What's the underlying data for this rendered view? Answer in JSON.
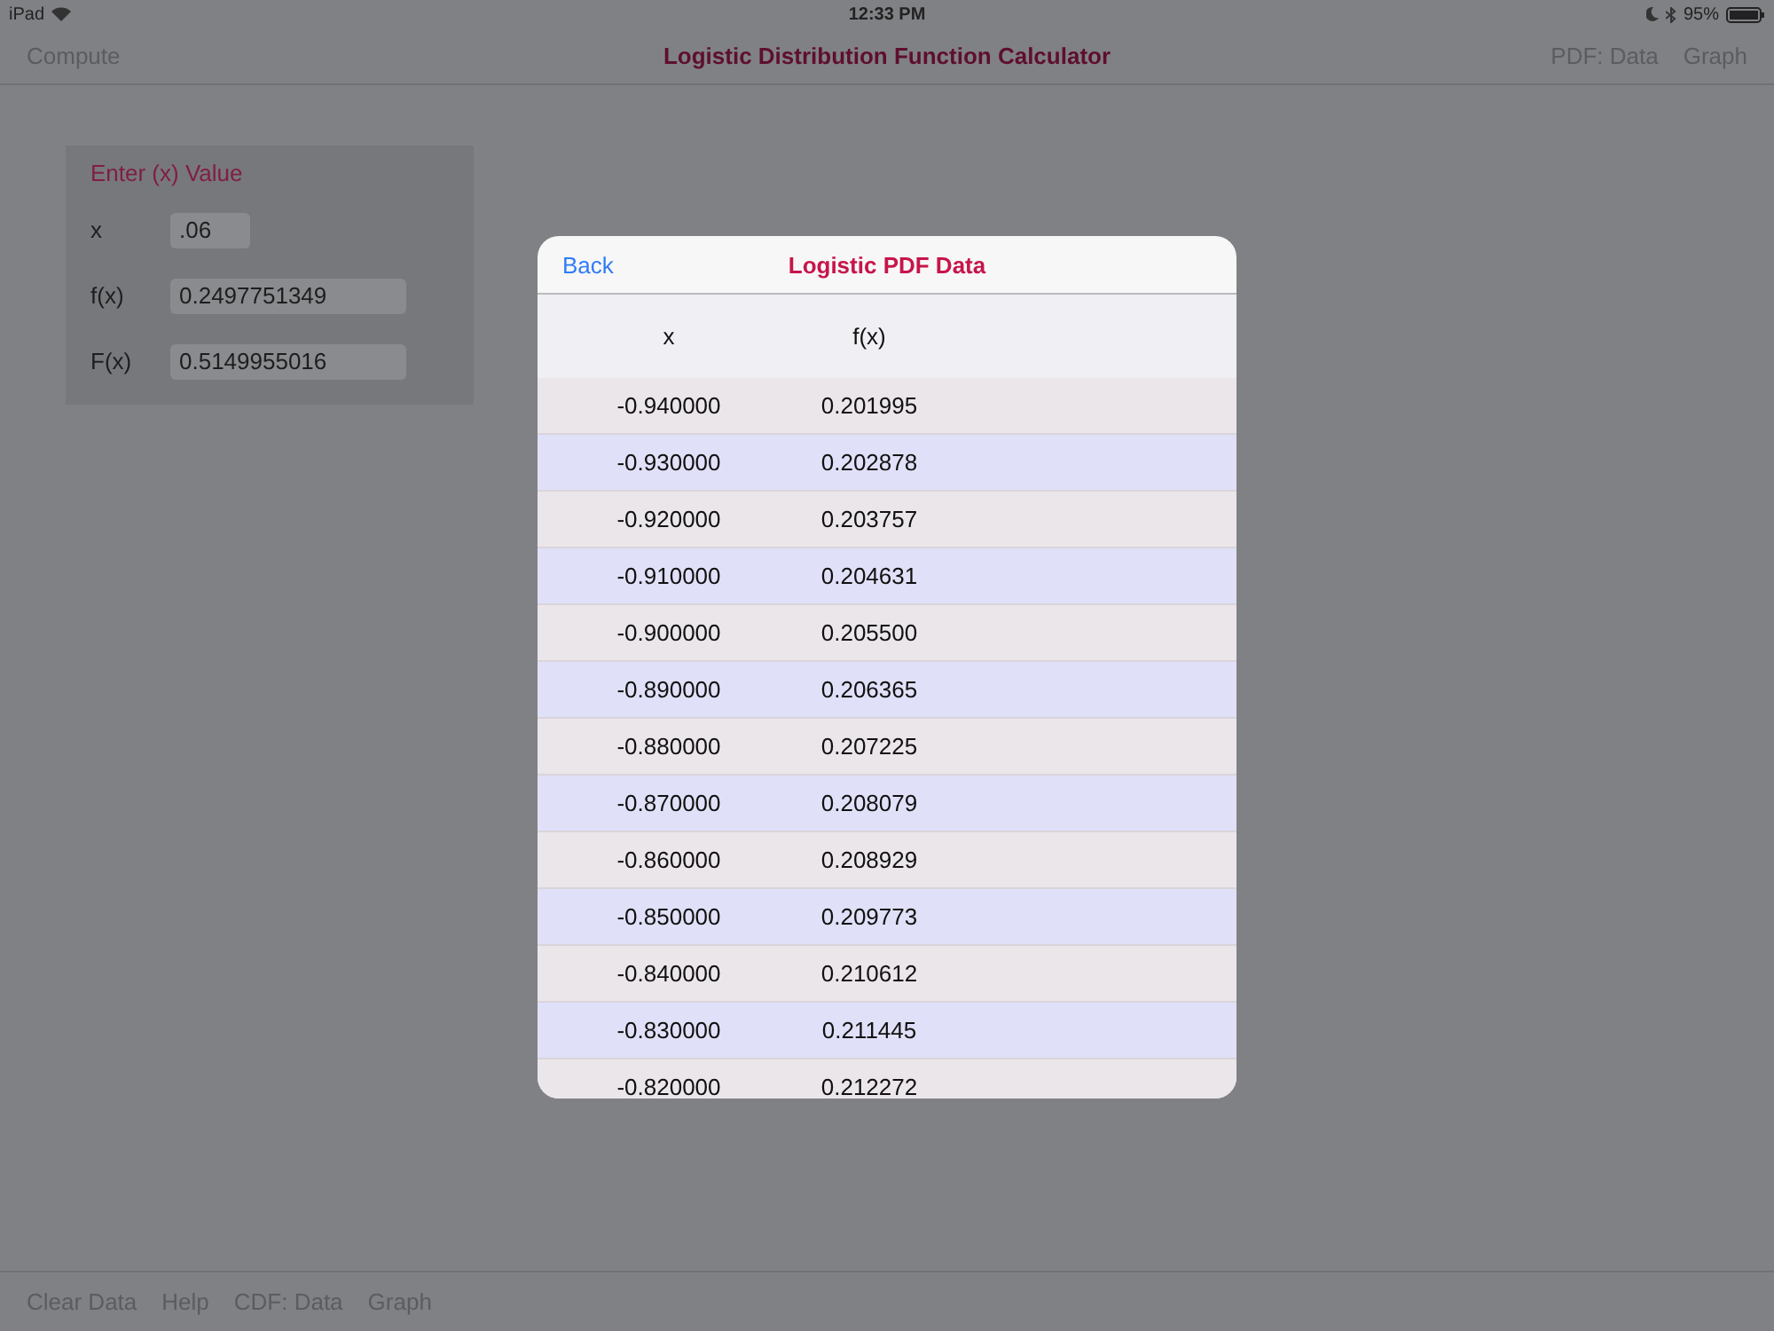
{
  "status_bar": {
    "device": "iPad",
    "time": "12:33 PM",
    "battery": "95%"
  },
  "nav_bar": {
    "left": "Compute",
    "title": "Logistic Distribution Function Calculator",
    "right": [
      "PDF: Data",
      "Graph"
    ]
  },
  "input_panel": {
    "title": "Enter (x) Value",
    "fields": [
      {
        "label": "x",
        "value": ".06"
      },
      {
        "label": "f(x)",
        "value": "0.2497751349"
      },
      {
        "label": "F(x)",
        "value": "0.5149955016"
      }
    ]
  },
  "modal": {
    "back": "Back",
    "title": "Logistic PDF Data",
    "columns": [
      "x",
      "f(x)"
    ],
    "rows": [
      [
        "-0.940000",
        "0.201995"
      ],
      [
        "-0.930000",
        "0.202878"
      ],
      [
        "-0.920000",
        "0.203757"
      ],
      [
        "-0.910000",
        "0.204631"
      ],
      [
        "-0.900000",
        "0.205500"
      ],
      [
        "-0.890000",
        "0.206365"
      ],
      [
        "-0.880000",
        "0.207225"
      ],
      [
        "-0.870000",
        "0.208079"
      ],
      [
        "-0.860000",
        "0.208929"
      ],
      [
        "-0.850000",
        "0.209773"
      ],
      [
        "-0.840000",
        "0.210612"
      ],
      [
        "-0.830000",
        "0.211445"
      ],
      [
        "-0.820000",
        "0.212272"
      ]
    ]
  },
  "toolbar": [
    "Clear Data",
    "Help",
    "CDF: Data",
    "Graph"
  ]
}
